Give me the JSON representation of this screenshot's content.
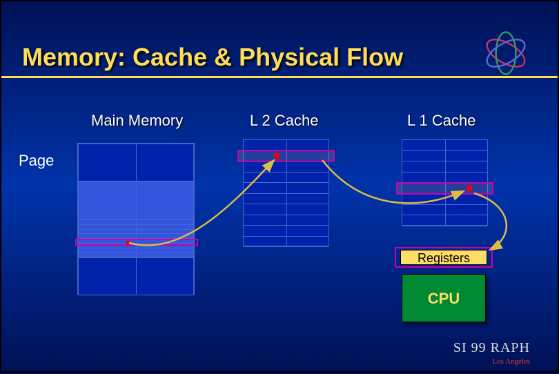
{
  "title": "Memory: Cache & Physical Flow",
  "labels": {
    "main_memory": "Main Memory",
    "l2_cache": "L 2 Cache",
    "l1_cache": "L 1 Cache",
    "page": "Page",
    "registers": "Registers",
    "cpu": "CPU"
  },
  "branding": {
    "siggraph": "SI 99 RAPH",
    "location": "Los Angeles"
  }
}
